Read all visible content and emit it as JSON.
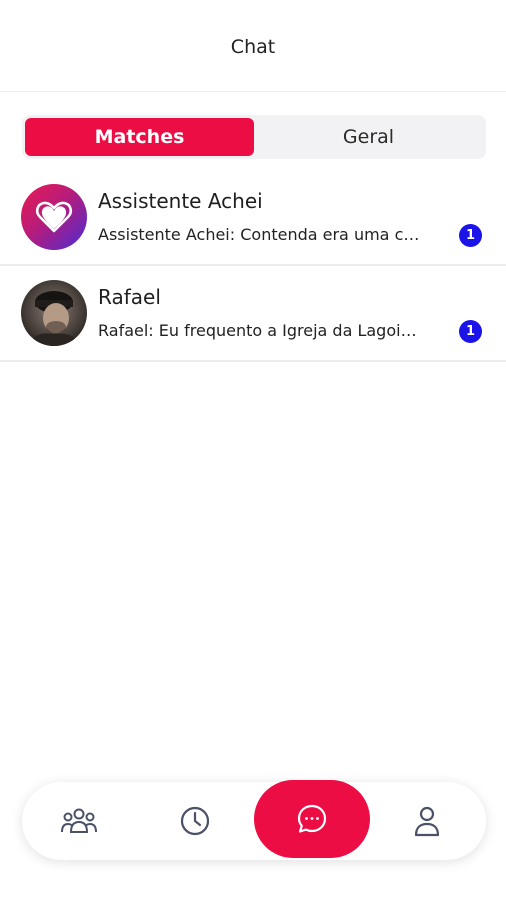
{
  "header": {
    "title": "Chat"
  },
  "tabs": [
    {
      "label": "Matches",
      "active": true
    },
    {
      "label": "Geral",
      "active": false
    }
  ],
  "conversations": [
    {
      "name": "Assistente Achei",
      "preview": "Assistente Achei: Contenda era uma cidade pequena",
      "unread": "1",
      "avatar": "brand-heart-logo"
    },
    {
      "name": "Rafael",
      "preview": "Rafael: Eu frequento a Igreja da Lagoinha",
      "unread": "1",
      "avatar": "user-photo"
    }
  ],
  "bottom_nav": [
    {
      "icon": "people-icon"
    },
    {
      "icon": "clock-icon"
    },
    {
      "icon": "chat-bubble-icon",
      "active": true
    },
    {
      "icon": "person-icon"
    }
  ],
  "colors": {
    "accent": "#ec0d45",
    "badge": "#1a14e8",
    "segment_bg": "#f2f2f4"
  }
}
